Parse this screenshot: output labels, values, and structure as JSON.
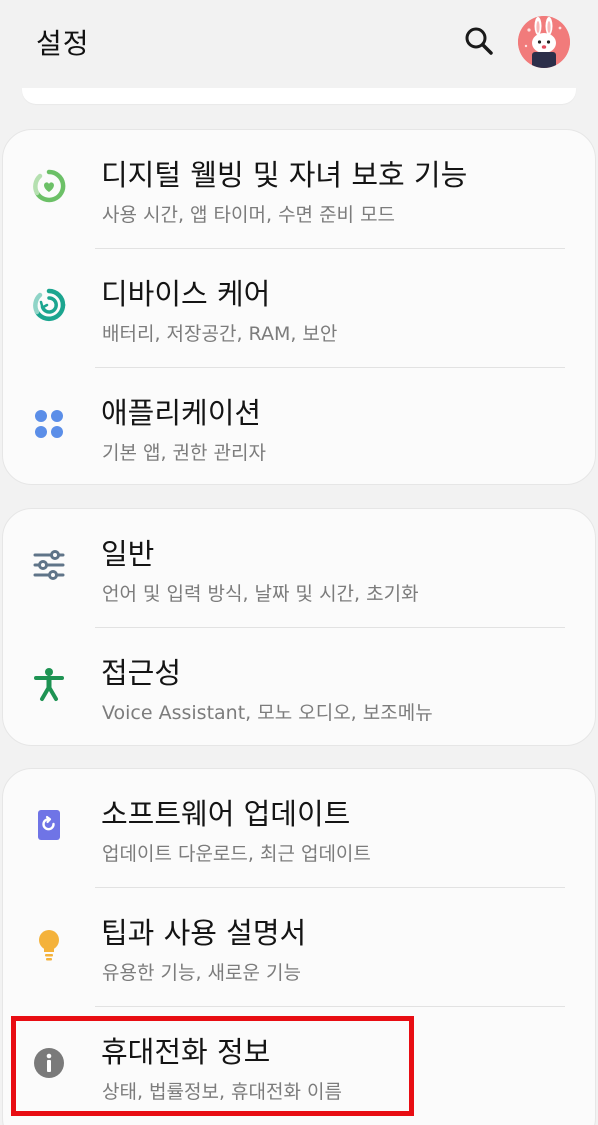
{
  "header": {
    "title": "설정",
    "search_icon": "search-icon",
    "avatar_icon": "bunny-avatar-icon"
  },
  "groups": [
    {
      "items": [
        {
          "title": "디지털 웰빙 및 자녀 보호 기능",
          "subtitle": "사용 시간, 앱 타이머, 수면 준비 모드",
          "icon": "digital-wellbeing-icon",
          "icon_color": "#6cc067"
        },
        {
          "title": "디바이스 케어",
          "subtitle": "배터리, 저장공간, RAM, 보안",
          "icon": "device-care-icon",
          "icon_color": "#1ba58f"
        },
        {
          "title": "애플리케이션",
          "subtitle": "기본 앱, 권한 관리자",
          "icon": "apps-icon",
          "icon_color": "#5b8ee8"
        }
      ]
    },
    {
      "items": [
        {
          "title": "일반",
          "subtitle": "언어 및 입력 방식, 날짜 및 시간, 초기화",
          "icon": "sliders-icon",
          "icon_color": "#5f7488"
        },
        {
          "title": "접근성",
          "subtitle": "Voice Assistant, 모노 오디오, 보조메뉴",
          "icon": "accessibility-icon",
          "icon_color": "#1e9353"
        }
      ]
    },
    {
      "items": [
        {
          "title": "소프트웨어 업데이트",
          "subtitle": "업데이트 다운로드, 최근 업데이트",
          "icon": "software-update-icon",
          "icon_color": "#6f74e6"
        },
        {
          "title": "팁과 사용 설명서",
          "subtitle": "유용한 기능, 새로운 기능",
          "icon": "lightbulb-icon",
          "icon_color": "#f4b23b"
        },
        {
          "title": "휴대전화 정보",
          "subtitle": "상태, 법률정보, 휴대전화 이름",
          "icon": "info-icon",
          "icon_color": "#7a7a7a"
        }
      ]
    }
  ],
  "colors": {
    "highlight": "#e80d13",
    "avatar_bg": "#f17b7b"
  }
}
